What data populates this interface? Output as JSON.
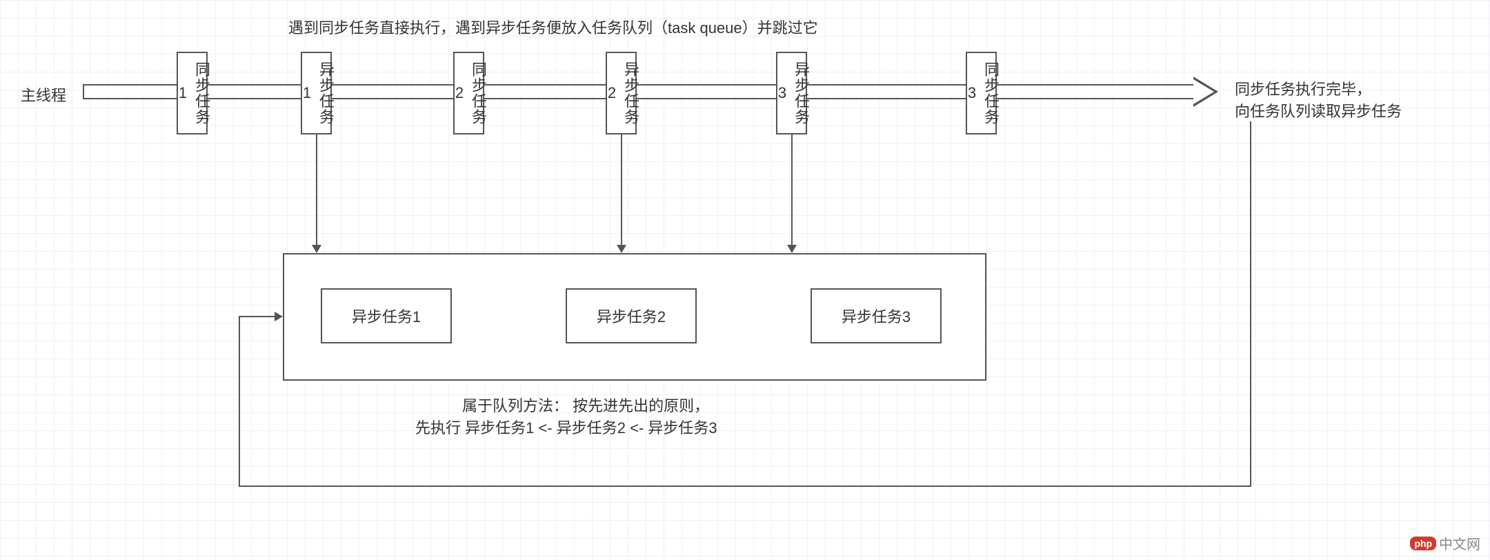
{
  "labels": {
    "top_note": "遇到同步任务直接执行，遇到异步任务便放入任务队列（task queue）并跳过它",
    "main_thread": "主线程",
    "right_note_line1": "同步任务执行完毕，",
    "right_note_line2": "向任务队列读取异步任务",
    "bottom_note_line1": "属于队列方法：  按先进先出的原则，",
    "bottom_note_line2": "先执行  异步任务1 <-  异步任务2 <-  异步任务3"
  },
  "timeline_tasks": [
    {
      "text": "同步任务1",
      "name": "sync-task-1"
    },
    {
      "text": "异步任务1",
      "name": "async-task-1-box"
    },
    {
      "text": "同步任务2",
      "name": "sync-task-2"
    },
    {
      "text": "异步任务2",
      "name": "async-task-2-box"
    },
    {
      "text": "异步任务3",
      "name": "async-task-3-box"
    },
    {
      "text": "同步任务3",
      "name": "sync-task-3"
    }
  ],
  "queue_items": [
    {
      "text": "异步任务1",
      "name": "queue-item-1"
    },
    {
      "text": "异步任务2",
      "name": "queue-item-2"
    },
    {
      "text": "异步任务3",
      "name": "queue-item-3"
    }
  ],
  "watermark": {
    "logo": "php",
    "text": "中文网"
  }
}
